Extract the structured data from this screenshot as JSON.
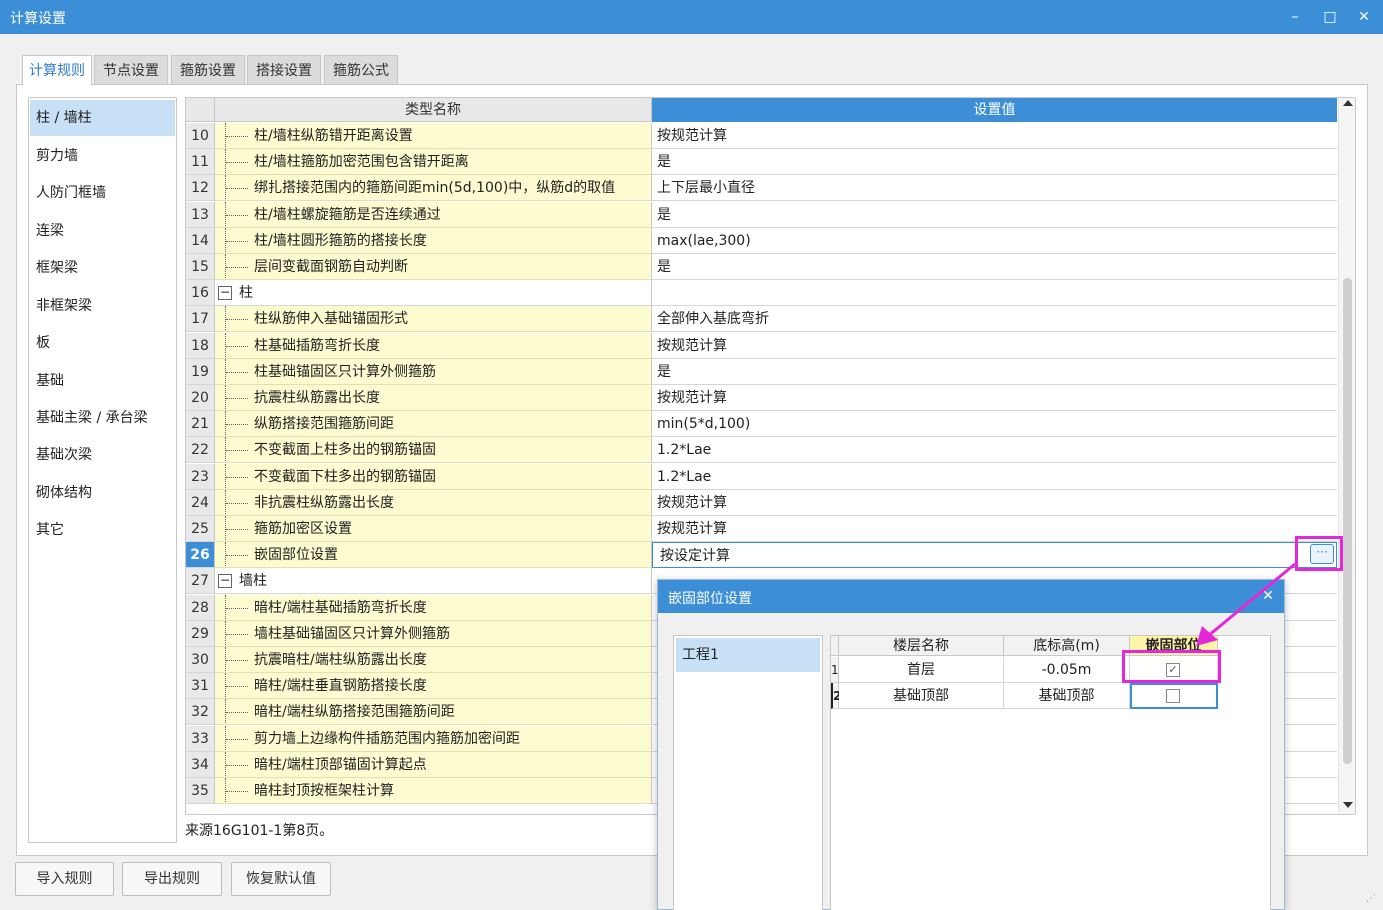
{
  "window": {
    "title": "计算设置",
    "minimize_label": "–",
    "maximize_label": "□",
    "close_label": "✕"
  },
  "tabs": [
    {
      "label": "计算规则",
      "active": true
    },
    {
      "label": "节点设置",
      "active": false
    },
    {
      "label": "箍筋设置",
      "active": false
    },
    {
      "label": "搭接设置",
      "active": false
    },
    {
      "label": "箍筋公式",
      "active": false
    }
  ],
  "sidebar": {
    "items": [
      {
        "label": "柱 / 墙柱",
        "active": true
      },
      {
        "label": "剪力墙"
      },
      {
        "label": "人防门框墙"
      },
      {
        "label": "连梁"
      },
      {
        "label": "框架梁"
      },
      {
        "label": "非框架梁"
      },
      {
        "label": "板"
      },
      {
        "label": "基础"
      },
      {
        "label": "基础主梁 / 承台梁"
      },
      {
        "label": "基础次梁"
      },
      {
        "label": "砌体结构"
      },
      {
        "label": "其它"
      }
    ]
  },
  "grid": {
    "header_name": "类型名称",
    "header_value": "设置值",
    "rows": [
      {
        "num": "10",
        "name": "柱/墙柱纵筋错开距离设置",
        "value": "按规范计算"
      },
      {
        "num": "11",
        "name": "柱/墙柱箍筋加密范围包含错开距离",
        "value": "是"
      },
      {
        "num": "12",
        "name": "绑扎搭接范围内的箍筋间距min(5d,100)中，纵筋d的取值",
        "value": "上下层最小直径"
      },
      {
        "num": "13",
        "name": "柱/墙柱螺旋箍筋是否连续通过",
        "value": "是"
      },
      {
        "num": "14",
        "name": "柱/墙柱圆形箍筋的搭接长度",
        "value": "max(lae,300)"
      },
      {
        "num": "15",
        "name": "层间变截面钢筋自动判断",
        "value": "是"
      },
      {
        "num": "16",
        "name": "柱",
        "value": "",
        "group": true,
        "toggle": "−"
      },
      {
        "num": "17",
        "name": "柱纵筋伸入基础锚固形式",
        "value": "全部伸入基底弯折"
      },
      {
        "num": "18",
        "name": "柱基础插筋弯折长度",
        "value": "按规范计算"
      },
      {
        "num": "19",
        "name": "柱基础锚固区只计算外侧箍筋",
        "value": "是"
      },
      {
        "num": "20",
        "name": "抗震柱纵筋露出长度",
        "value": "按规范计算"
      },
      {
        "num": "21",
        "name": "纵筋搭接范围箍筋间距",
        "value": "min(5*d,100)"
      },
      {
        "num": "22",
        "name": "不变截面上柱多出的钢筋锚固",
        "value": "1.2*Lae"
      },
      {
        "num": "23",
        "name": "不变截面下柱多出的钢筋锚固",
        "value": "1.2*Lae"
      },
      {
        "num": "24",
        "name": "非抗震柱纵筋露出长度",
        "value": "按规范计算"
      },
      {
        "num": "25",
        "name": "箍筋加密区设置",
        "value": "按规范计算"
      },
      {
        "num": "26",
        "name": "嵌固部位设置",
        "value": "按设定计算",
        "selected": true
      },
      {
        "num": "27",
        "name": "墙柱",
        "value": "",
        "group": true,
        "toggle": "−"
      },
      {
        "num": "28",
        "name": "暗柱/端柱基础插筋弯折长度",
        "value": ""
      },
      {
        "num": "29",
        "name": "墙柱基础锚固区只计算外侧箍筋",
        "value": ""
      },
      {
        "num": "30",
        "name": "抗震暗柱/端柱纵筋露出长度",
        "value": ""
      },
      {
        "num": "31",
        "name": "暗柱/端柱垂直钢筋搭接长度",
        "value": ""
      },
      {
        "num": "32",
        "name": "暗柱/端柱纵筋搭接范围箍筋间距",
        "value": ""
      },
      {
        "num": "33",
        "name": "剪力墙上边缘构件插筋范围内箍筋加密间距",
        "value": ""
      },
      {
        "num": "34",
        "name": "暗柱/端柱顶部锚固计算起点",
        "value": ""
      },
      {
        "num": "35",
        "name": "暗柱封顶按框架柱计算",
        "value": ""
      }
    ],
    "ellipsis_label": "···"
  },
  "source_note": "来源16G101-1第8页。",
  "buttons": {
    "import": "导入规则",
    "export": "导出规则",
    "restore": "恢复默认值"
  },
  "dialog": {
    "title": "嵌固部位设置",
    "close_label": "✕",
    "tree_item": "工程1",
    "headers": [
      "楼层名称",
      "底标高(m)",
      "嵌固部位"
    ],
    "rows": [
      {
        "num": "1",
        "floor": "首层",
        "elevation": "-0.05m",
        "checked": true
      },
      {
        "num": "2",
        "floor": "基础顶部",
        "elevation": "基础顶部",
        "checked": false
      }
    ],
    "check_mark": "✓"
  },
  "colors": {
    "titlebar": "#3c8fd6",
    "highlight": "#e627d9",
    "name_cell_bg": "#fdfbd0",
    "selection": "#c7e0f6"
  }
}
